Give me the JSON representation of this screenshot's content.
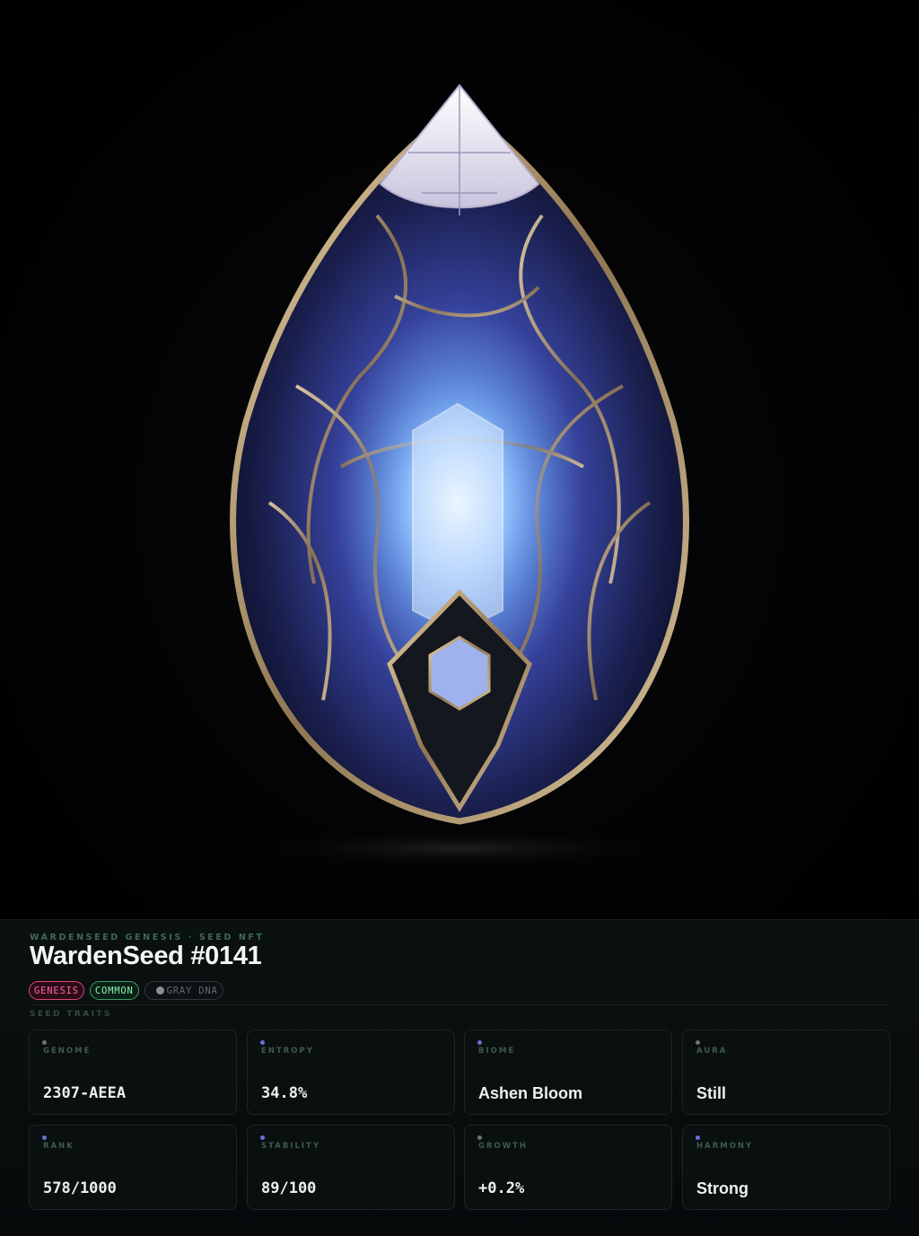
{
  "eyebrow": "WARDENSEED GENESIS · SEED NFT",
  "title": "WardenSeed #0141",
  "tags": {
    "genesis": "GENESIS",
    "rarity": "COMMON",
    "dna": "GRAY DNA"
  },
  "section_label": "SEED TRAITS",
  "traits": [
    {
      "label": "GENOME",
      "value": "2307-AEEA",
      "dot_color": "#6b7472"
    },
    {
      "label": "ENTROPY",
      "value": "34.8%",
      "dot_color": "#6b6fd4"
    },
    {
      "label": "BIOME",
      "value": "Ashen Bloom",
      "dot_color": "#6b6fd4"
    },
    {
      "label": "AURA",
      "value": "Still",
      "dot_color": "#6b7472"
    },
    {
      "label": "RANK",
      "value": "578/1000",
      "dot_color": "#6b6fd4"
    },
    {
      "label": "STABILITY",
      "value": "89/100",
      "dot_color": "#6b6fd4"
    },
    {
      "label": "GROWTH",
      "value": "+0.2%",
      "dot_color": "#6b7472"
    },
    {
      "label": "HARMONY",
      "value": "Strong",
      "dot_color": "#6b6fd4"
    }
  ],
  "colors": {
    "genesis_accent": "#ff6aa0",
    "common_accent": "#8ff0b4",
    "dna_dot": "#8a8f8f"
  },
  "hero_image": "crystal-seed-egg-artwork"
}
